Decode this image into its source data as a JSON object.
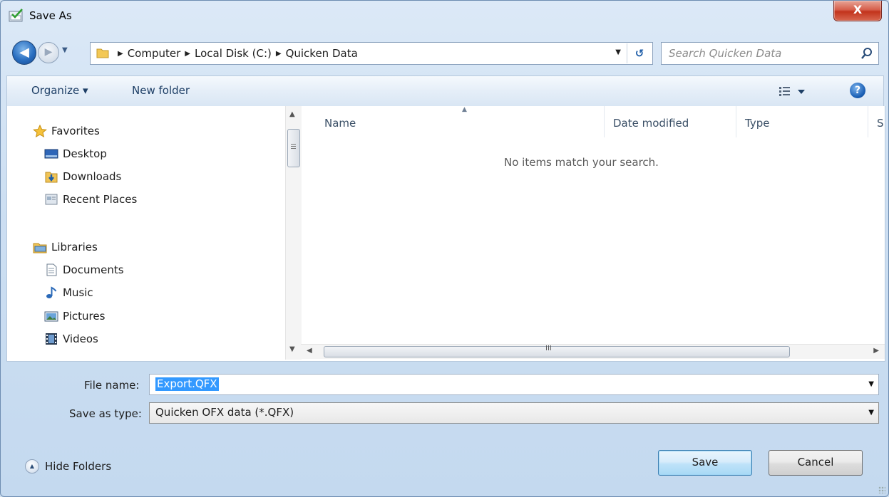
{
  "window": {
    "title": "Save As",
    "close_label": "X"
  },
  "nav": {
    "back_glyph": "◀",
    "forward_glyph": "▶",
    "breadcrumbs": [
      "Computer",
      "Local Disk (C:)",
      "Quicken Data"
    ],
    "search_placeholder": "Search Quicken Data"
  },
  "toolbar": {
    "organize_label": "Organize ▾",
    "new_folder_label": "New folder",
    "help_label": "?"
  },
  "sidebar": {
    "groups": [
      {
        "label": "Favorites",
        "icon": "star-icon",
        "items": [
          {
            "label": "Desktop",
            "icon": "desktop-icon"
          },
          {
            "label": "Downloads",
            "icon": "downloads-icon"
          },
          {
            "label": "Recent Places",
            "icon": "recent-places-icon"
          }
        ]
      },
      {
        "label": "Libraries",
        "icon": "libraries-icon",
        "items": [
          {
            "label": "Documents",
            "icon": "documents-icon"
          },
          {
            "label": "Music",
            "icon": "music-icon"
          },
          {
            "label": "Pictures",
            "icon": "pictures-icon"
          },
          {
            "label": "Videos",
            "icon": "videos-icon"
          }
        ]
      }
    ]
  },
  "file_list": {
    "columns": [
      "Name",
      "Date modified",
      "Type",
      "S"
    ],
    "empty_message": "No items match your search.",
    "hscroll_grip": "III"
  },
  "form": {
    "file_name_label": "File name:",
    "file_name_value": "Export.QFX",
    "save_type_label": "Save as type:",
    "save_type_value": "Quicken OFX data (*.QFX)"
  },
  "footer": {
    "hide_folders_label": "Hide Folders",
    "save_label": "Save",
    "cancel_label": "Cancel"
  },
  "colors": {
    "accent": "#3399ff",
    "window_frame": "#cddff2",
    "close_button": "#c2331c"
  }
}
